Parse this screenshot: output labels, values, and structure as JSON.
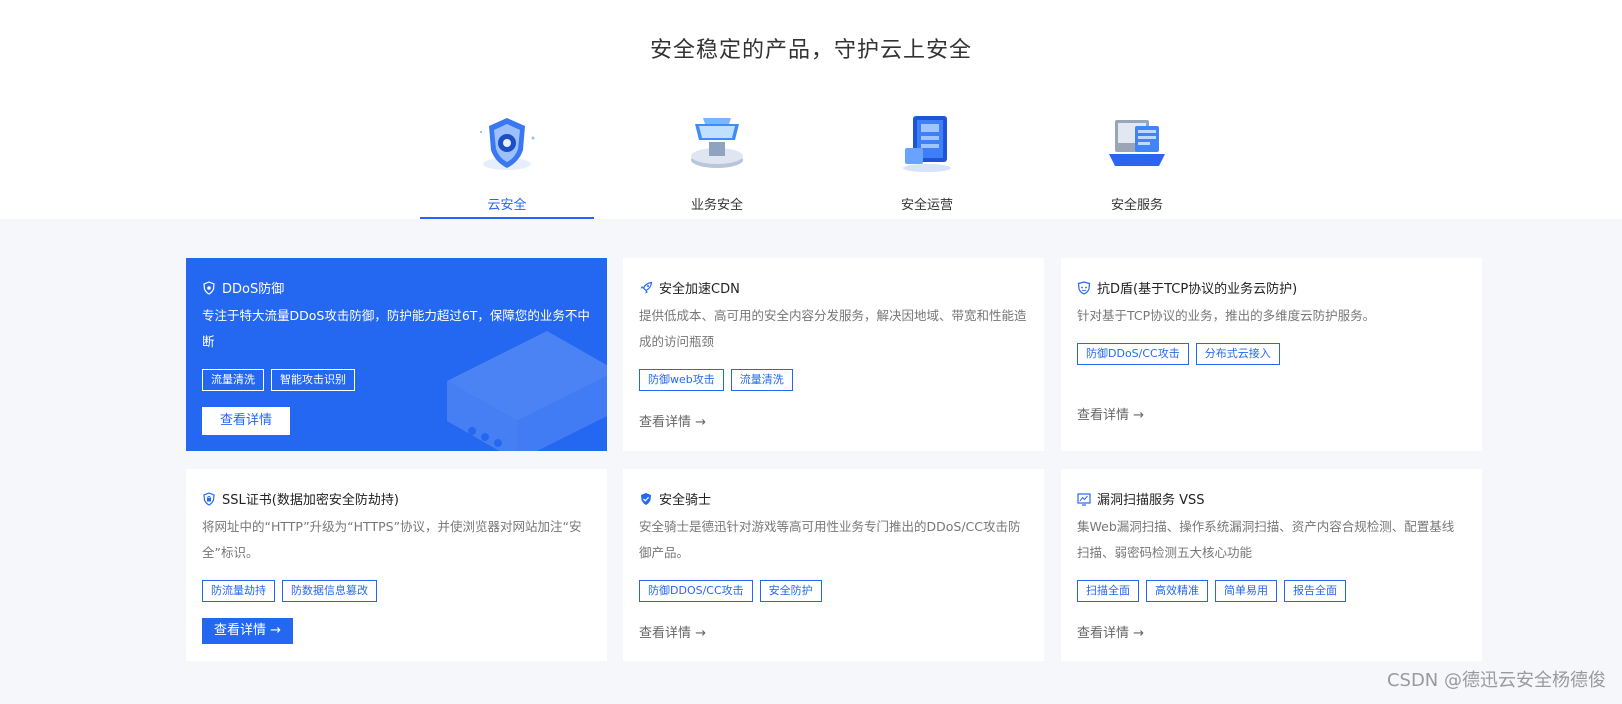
{
  "section": {
    "title": "安全稳定的产品，守护云上安全"
  },
  "tabs": [
    {
      "label": "云安全",
      "icon": "shield-illustration-icon",
      "active": true
    },
    {
      "label": "业务安全",
      "icon": "platform-illustration-icon"
    },
    {
      "label": "安全运营",
      "icon": "server-illustration-icon"
    },
    {
      "label": "安全服务",
      "icon": "laptop-illustration-icon"
    }
  ],
  "cards": [
    {
      "title": "DDoS防御",
      "icon": "shield-icon",
      "desc": "专注于特大流量DDoS攻击防御，防护能力超过6T，保障您的业务不中断",
      "tags": [
        "流量清洗",
        "智能攻击识别"
      ],
      "action": "查看详情"
    },
    {
      "title": "安全加速CDN",
      "icon": "rocket-icon",
      "desc": "提供低成本、高可用的安全内容分发服务，解决因地域、带宽和性能造成的访问瓶颈",
      "tags": [
        "防御web攻击",
        "流量清洗"
      ],
      "action": "查看详情 →"
    },
    {
      "title": "抗D盾(基于TCP协议的业务云防护)",
      "icon": "shield-face-icon",
      "desc": "针对基于TCP协议的业务，推出的多维度云防护服务。",
      "tags": [
        "防御DDoS/CC攻击",
        "分布式云接入"
      ],
      "action": "查看详情 →"
    },
    {
      "title": "SSL证书(数据加密安全防劫持)",
      "icon": "ssl-shield-icon",
      "desc": "将网址中的“HTTP”升级为“HTTPS”协议，并使浏览器对网站加注“安全”标识。",
      "tags": [
        "防流量劫持",
        "防数据信息篡改"
      ],
      "action": "查看详情 →"
    },
    {
      "title": "安全骑士",
      "icon": "check-shield-icon",
      "desc": "安全骑士是德迅针对游戏等高可用性业务专门推出的DDoS/CC攻击防御产品。",
      "tags": [
        "防御DDOS/CC攻击",
        "安全防护"
      ],
      "action": "查看详情 →"
    },
    {
      "title": "漏洞扫描服务 VSS",
      "icon": "monitor-chart-icon",
      "desc": "集Web漏洞扫描、操作系统漏洞扫描、资产内容合规检测、配置基线扫描、弱密码检测五大核心功能",
      "tags": [
        "扫描全面",
        "高效精准",
        "简单易用",
        "报告全面"
      ],
      "action": "查看详情 →"
    }
  ],
  "watermark": "CSDN @德迅云安全杨德俊",
  "colors": {
    "accent": "#2468f2",
    "background": "#f6f7fb"
  }
}
